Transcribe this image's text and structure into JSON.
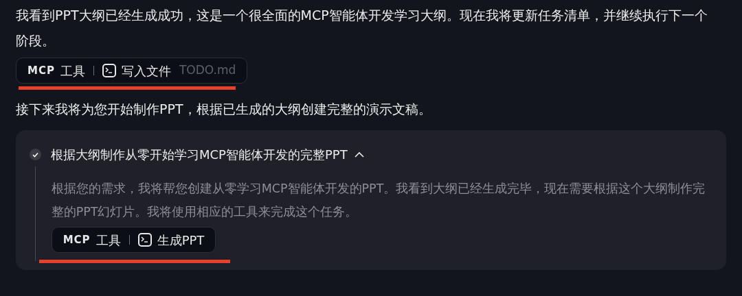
{
  "intro": "我看到PPT大纲已经生成成功，这是一个很全面的MCP智能体开发学习大纲。现在我将更新任务清单，并继续执行下一个阶段。",
  "tool_call_1": {
    "source": "MCP",
    "label": "工具",
    "action": "写入文件",
    "target": "TODO.md",
    "underlined": true
  },
  "next": "接下来我将为您开始制作PPT，根据已生成的大纲创建完整的演示文稿。",
  "task": {
    "title": "根据大纲制作从零开始学习MCP智能体开发的完整PPT",
    "done": true,
    "expanded": true,
    "body": "根据您的需求，我将帮您创建从零学习MCP智能体开发的PPT。我看到大纲已经生成完毕，现在需要根据这个大纲制作完整的PPT幻灯片。我将使用相应的工具来完成这个任务。",
    "tool_call": {
      "source": "MCP",
      "label": "工具",
      "action": "生成PPT",
      "underlined": true
    }
  }
}
